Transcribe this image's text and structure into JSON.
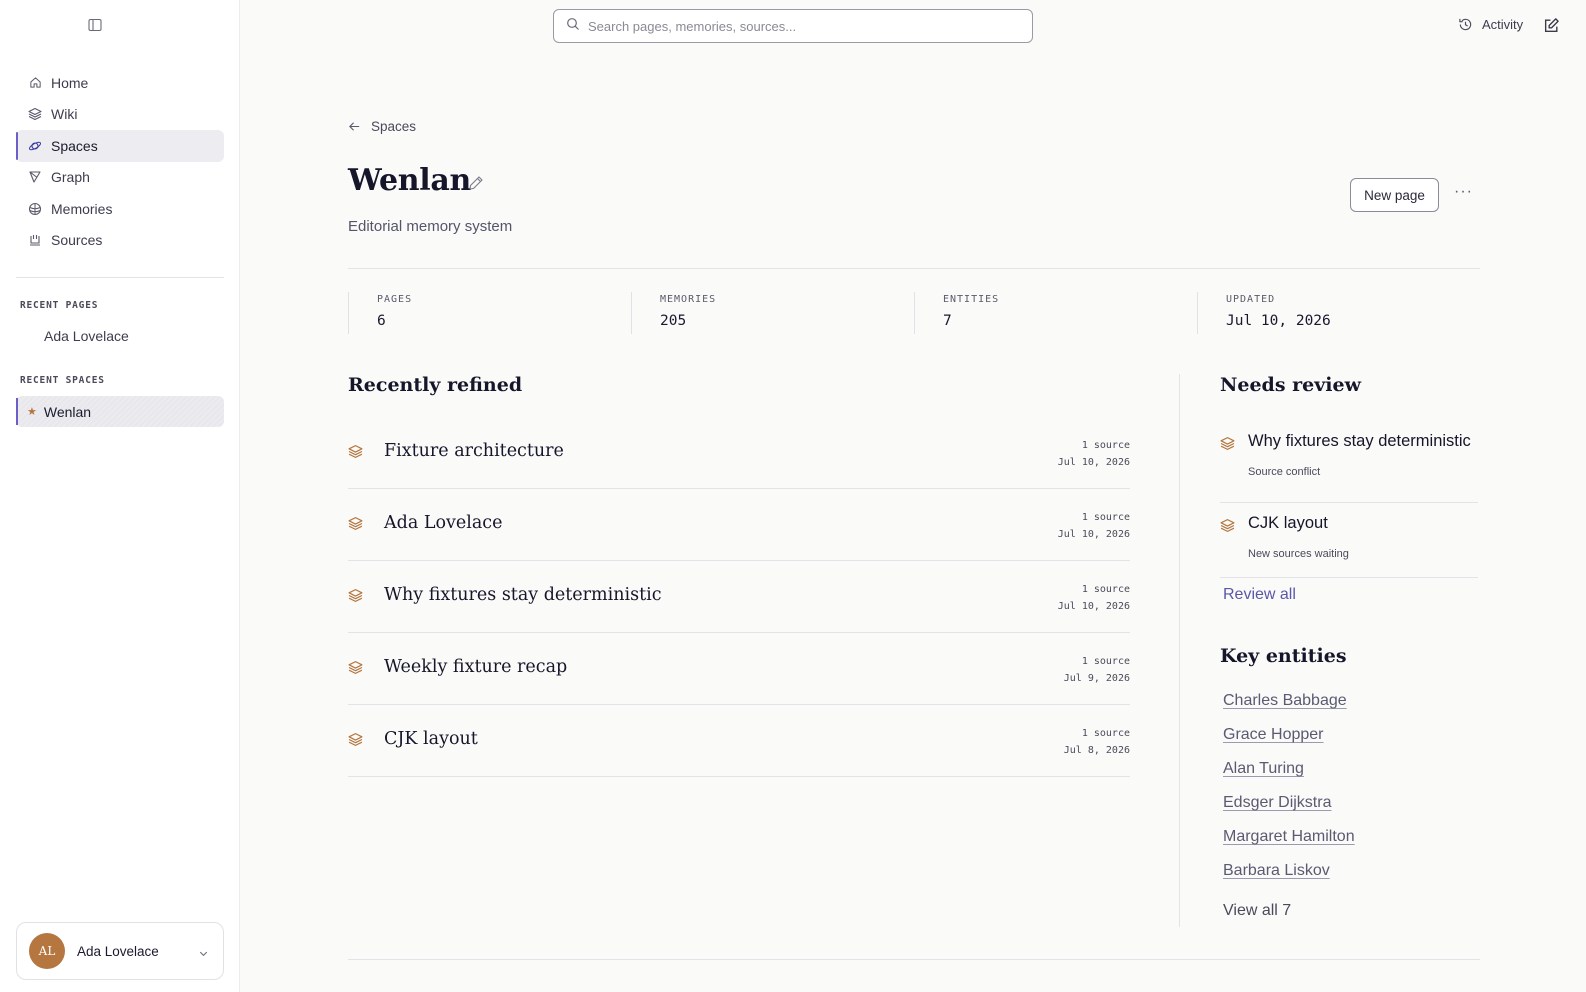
{
  "sidebar": {
    "nav": [
      {
        "label": "Home",
        "icon": "home-icon",
        "active": false
      },
      {
        "label": "Wiki",
        "icon": "layers-icon",
        "active": false
      },
      {
        "label": "Spaces",
        "icon": "orbit-icon",
        "active": true
      },
      {
        "label": "Graph",
        "icon": "graph-icon",
        "active": false
      },
      {
        "label": "Memories",
        "icon": "brain-icon",
        "active": false
      },
      {
        "label": "Sources",
        "icon": "sources-icon",
        "active": false
      }
    ],
    "recent_pages_heading": "RECENT PAGES",
    "recent_pages": [
      "Ada Lovelace"
    ],
    "recent_spaces_heading": "RECENT SPACES",
    "recent_spaces": [
      "Wenlan"
    ],
    "user": {
      "initials": "AL",
      "name": "Ada Lovelace"
    }
  },
  "topbar": {
    "search_placeholder": "Search pages, memories, sources...",
    "activity_label": "Activity"
  },
  "page": {
    "breadcrumb": "Spaces",
    "title": "Wenlan",
    "subtitle": "Editorial memory system",
    "new_page_label": "New page",
    "more_label": "···"
  },
  "stats": [
    {
      "label": "PAGES",
      "value": "6"
    },
    {
      "label": "MEMORIES",
      "value": "205"
    },
    {
      "label": "ENTITIES",
      "value": "7"
    },
    {
      "label": "UPDATED",
      "value": "Jul 10, 2026"
    }
  ],
  "recently_refined": {
    "heading": "Recently refined",
    "items": [
      {
        "title": "Fixture architecture",
        "sources": "1 source",
        "date": "Jul 10, 2026"
      },
      {
        "title": "Ada Lovelace",
        "sources": "1 source",
        "date": "Jul 10, 2026"
      },
      {
        "title": "Why fixtures stay deterministic",
        "sources": "1 source",
        "date": "Jul 10, 2026"
      },
      {
        "title": "Weekly fixture recap",
        "sources": "1 source",
        "date": "Jul 9, 2026"
      },
      {
        "title": "CJK layout",
        "sources": "1 source",
        "date": "Jul 8, 2026"
      }
    ]
  },
  "needs_review": {
    "heading": "Needs review",
    "items": [
      {
        "title": "Why fixtures stay deterministic",
        "note": "Source conflict"
      },
      {
        "title": "CJK layout",
        "note": "New sources waiting"
      }
    ],
    "review_all_label": "Review all"
  },
  "key_entities": {
    "heading": "Key entities",
    "items": [
      "Charles Babbage",
      "Grace Hopper",
      "Alan Turing",
      "Edsger Dijkstra",
      "Margaret Hamilton",
      "Barbara Liskov"
    ],
    "view_all_label": "View all 7"
  },
  "colors": {
    "accent": "#6b5fc7",
    "brand_orange": "#b5763f",
    "link": "#5b57a8"
  }
}
